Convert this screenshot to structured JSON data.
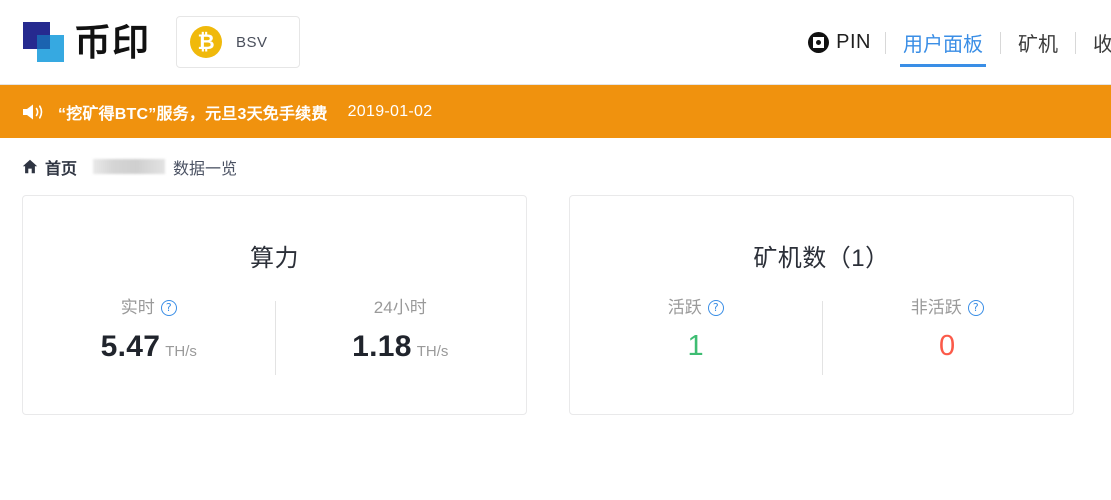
{
  "header": {
    "logo_text": "币印",
    "coin_selector": {
      "icon": "bitcoin-icon",
      "symbol": "₿",
      "label": "BSV"
    },
    "nav": [
      {
        "label": "PIN",
        "icon": "pin-icon",
        "active": false
      },
      {
        "label": "用户面板",
        "active": true
      },
      {
        "label": "矿机",
        "active": false
      },
      {
        "label": "收",
        "active": false,
        "clipped": true
      }
    ]
  },
  "banner": {
    "icon": "megaphone-icon",
    "text": "“挖矿得BTC”服务，元旦3天免手续费",
    "date": "2019-01-02",
    "color": "#f0920e"
  },
  "breadcrumb": {
    "home_icon": "home-icon",
    "home": "首页",
    "redacted": "",
    "tail": "数据一览"
  },
  "cards": [
    {
      "title": "算力",
      "columns": [
        {
          "label": "实时",
          "has_help": true,
          "help_icon": "question-circle-icon",
          "value": "5.47",
          "unit": "TH/s",
          "color": "#20242c"
        },
        {
          "label": "24小时",
          "has_help": false,
          "value": "1.18",
          "unit": "TH/s",
          "color": "#20242c"
        }
      ]
    },
    {
      "title": "矿机数（1）",
      "columns": [
        {
          "label": "活跃",
          "has_help": true,
          "help_icon": "question-circle-icon",
          "value": "1",
          "unit": "",
          "color": "#3ebd72"
        },
        {
          "label": "非活跃",
          "has_help": true,
          "help_icon": "question-circle-icon",
          "value": "0",
          "unit": "",
          "color": "#fb5a49"
        }
      ]
    }
  ]
}
